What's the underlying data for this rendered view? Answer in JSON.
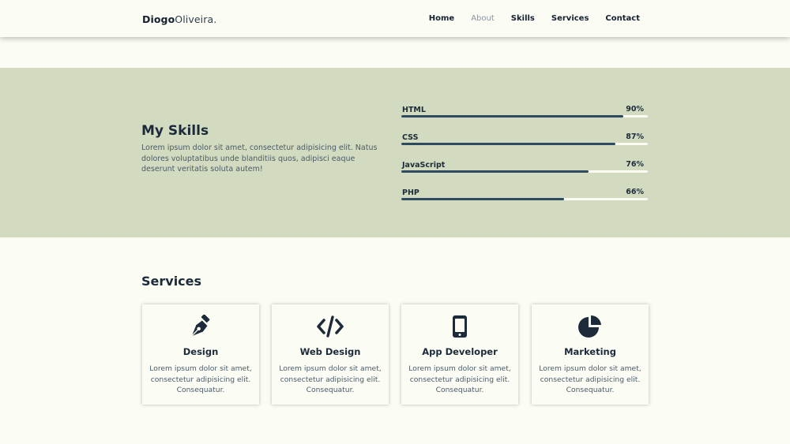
{
  "header": {
    "logo_bold": "Diogo",
    "logo_light": "Oliveira.",
    "nav": [
      {
        "label": "Home",
        "muted": false
      },
      {
        "label": "About",
        "muted": true
      },
      {
        "label": "Skills",
        "muted": false
      },
      {
        "label": "Services",
        "muted": false
      },
      {
        "label": "Contact",
        "muted": false
      }
    ]
  },
  "skills": {
    "title": "My Skills",
    "text": "Lorem ipsum dolor sit amet, consectetur adipisicing elit. Natus dolores voluptatibus unde blanditiis quos, adipisci eaque deserunt veritatis soluta autem!",
    "items": [
      {
        "name": "HTML",
        "percent_label": "90%",
        "percent": 90
      },
      {
        "name": "CSS",
        "percent_label": "87%",
        "percent": 87
      },
      {
        "name": "JavaScript",
        "percent_label": "76%",
        "percent": 76
      },
      {
        "name": "PHP",
        "percent_label": "66%",
        "percent": 66
      }
    ]
  },
  "services": {
    "title": "Services",
    "cards": [
      {
        "icon": "pen-nib-icon",
        "title": "Design",
        "text": "Lorem ipsum dolor sit amet, consectetur adipisicing elit. Consequatur."
      },
      {
        "icon": "code-icon",
        "title": "Web Design",
        "text": "Lorem ipsum dolor sit amet, consectetur adipisicing elit. Consequatur."
      },
      {
        "icon": "mobile-phone-icon",
        "title": "App Developer",
        "text": "Lorem ipsum dolor sit amet, consectetur adipisicing elit. Consequatur."
      },
      {
        "icon": "pie-chart-icon",
        "title": "Marketing",
        "text": "Lorem ipsum dolor sit amet, consectetur adipisicing elit. Consequatur."
      }
    ]
  },
  "colors": {
    "background": "#fbfdf5",
    "band": "#d2dbbf",
    "text_dark": "#1c2a3a",
    "bar_fill": "#2e4a5e"
  }
}
